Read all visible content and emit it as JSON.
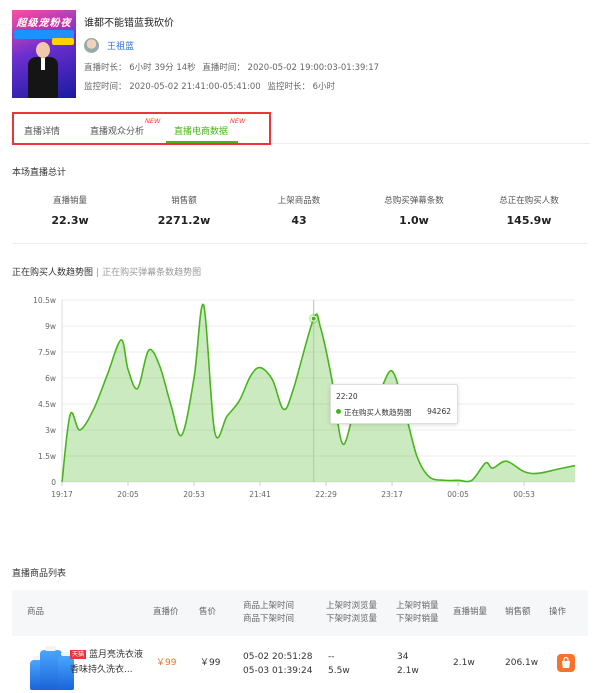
{
  "header": {
    "title": "谁都不能错蓝我砍价",
    "cover_title": "超级宠粉夜",
    "anchor_name": "王祖蓝",
    "meta_line1": [
      "直播时长： 6小时 39分 14秒",
      "直播时间： 2020-05-02 19:00:03-01:39:17"
    ],
    "meta_line2": [
      "监控时间： 2020-05-02 21:41:00-05:41:00",
      "监控时长： 6小时"
    ]
  },
  "tabs": [
    {
      "label": "直播详情",
      "new": ""
    },
    {
      "label": "直播观众分析",
      "new": "NEW"
    },
    {
      "label": "直播电商数据",
      "new": "NEW",
      "active": true
    }
  ],
  "summary": {
    "title": "本场直播总计",
    "stats": [
      {
        "label": "直播销量",
        "value": "22.3w"
      },
      {
        "label": "销售额",
        "value": "2271.2w"
      },
      {
        "label": "上架商品数",
        "value": "43"
      },
      {
        "label": "总购买弹幕条数",
        "value": "1.0w"
      },
      {
        "label": "总正在购买人数",
        "value": "145.9w"
      }
    ]
  },
  "chart_section": {
    "title": "正在购买人数趋势图",
    "separator": "|",
    "alt_title": "正在购买弹幕条数趋势图",
    "tooltip": {
      "time": "22:20",
      "series": "正在购买人数趋势图",
      "value": "94262"
    }
  },
  "chart_data": {
    "type": "area",
    "title": "正在购买人数趋势图",
    "y_tick_labels": [
      "0",
      "1.5w",
      "3w",
      "4.5w",
      "6w",
      "7.5w",
      "9w",
      "10.5w"
    ],
    "y_ticks": [
      0,
      15000,
      30000,
      45000,
      60000,
      75000,
      90000,
      105000
    ],
    "ylim": [
      0,
      105000
    ],
    "x_tick_labels": [
      "19:17",
      "20:05",
      "20:53",
      "21:41",
      "22:29",
      "23:17",
      "00:05",
      "00:53"
    ],
    "grid": true,
    "color": "#47b51d",
    "highlight": {
      "time": "22:20",
      "value": 94262
    },
    "series": [
      {
        "name": "正在购买人数趋势图",
        "points": [
          [
            "19:17",
            0
          ],
          [
            "19:23",
            39000
          ],
          [
            "19:30",
            30000
          ],
          [
            "19:40",
            42000
          ],
          [
            "19:50",
            62000
          ],
          [
            "20:00",
            82000
          ],
          [
            "20:05",
            65000
          ],
          [
            "20:12",
            54000
          ],
          [
            "20:20",
            76000
          ],
          [
            "20:28",
            67000
          ],
          [
            "20:36",
            45000
          ],
          [
            "20:44",
            27000
          ],
          [
            "20:53",
            60000
          ],
          [
            "21:00",
            102000
          ],
          [
            "21:08",
            29000
          ],
          [
            "21:17",
            38000
          ],
          [
            "21:26",
            47000
          ],
          [
            "21:34",
            61000
          ],
          [
            "21:41",
            66000
          ],
          [
            "21:50",
            59000
          ],
          [
            "21:58",
            42000
          ],
          [
            "22:05",
            53000
          ],
          [
            "22:20",
            94262
          ],
          [
            "22:25",
            89000
          ],
          [
            "22:33",
            60000
          ],
          [
            "22:41",
            22000
          ],
          [
            "22:50",
            42000
          ],
          [
            "23:00",
            52000
          ],
          [
            "23:08",
            53000
          ],
          [
            "23:17",
            64000
          ],
          [
            "23:26",
            42000
          ],
          [
            "23:35",
            15000
          ],
          [
            "23:44",
            3000
          ],
          [
            "23:55",
            1000
          ],
          [
            "00:05",
            1000
          ],
          [
            "00:15",
            1000
          ],
          [
            "00:25",
            11000
          ],
          [
            "00:30",
            8000
          ],
          [
            "00:40",
            12000
          ],
          [
            "00:53",
            6000
          ],
          [
            "01:03",
            5000
          ],
          [
            "01:18",
            7500
          ],
          [
            "01:30",
            9500
          ]
        ]
      }
    ]
  },
  "products": {
    "title": "直播商品列表",
    "headers": {
      "product": "商品",
      "live_price": "直播价",
      "price": "售价",
      "time": [
        "商品上架时间",
        "商品下架时间"
      ],
      "views": [
        "上架时浏览量",
        "下架时浏览量"
      ],
      "sales_at": [
        "上架时销量",
        "下架时销量"
      ],
      "live_sales": "直播销量",
      "revenue": "销售额",
      "action": "操作"
    },
    "rows": [
      {
        "badge": "天猫",
        "name_line1": "蓝月亮洗衣液",
        "name_line2": "香味持久洗衣...",
        "live_price": "￥99",
        "price": "￥99",
        "time_on": "05-02 20:51:28",
        "time_off": "05-03 01:39:24",
        "views_on": "--",
        "views_off": "5.5w",
        "sales_on": "34",
        "sales_off": "2.1w",
        "live_sales": "2.1w",
        "revenue": "206.1w",
        "action_icon": "shopping-bag-icon"
      }
    ]
  }
}
